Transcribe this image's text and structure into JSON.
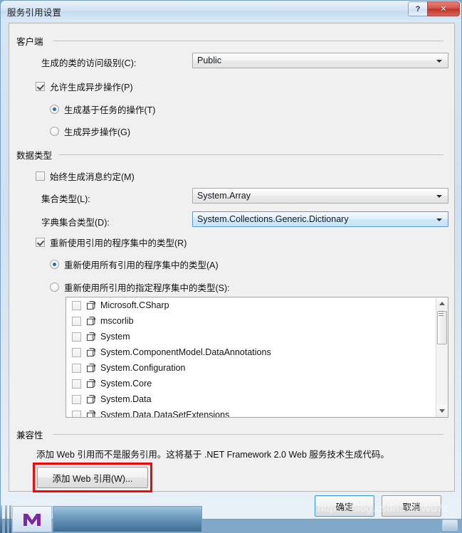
{
  "window": {
    "title": "服务引用设置",
    "help_button": "?",
    "close_button": "✕"
  },
  "sections": {
    "client": {
      "title": "客户端",
      "access_level_label": "生成的类的访问级别(C):",
      "access_level_value": "Public",
      "allow_async_label": "允许生成异步操作(P)",
      "allow_async_checked": true,
      "task_based_label": "生成基于任务的操作(T)",
      "async_op_label": "生成异步操作(G)",
      "op_selected": "task_based"
    },
    "datatype": {
      "title": "数据类型",
      "always_message_contract_label": "始终生成消息约定(M)",
      "always_message_contract_checked": false,
      "collection_type_label": "集合类型(L):",
      "collection_type_value": "System.Array",
      "dictionary_type_label": "字典集合类型(D):",
      "dictionary_type_value": "System.Collections.Generic.Dictionary",
      "dictionary_focused": true,
      "reuse_types_label": "重新使用引用的程序集中的类型(R)",
      "reuse_types_checked": true,
      "reuse_all_label": "重新使用所有引用的程序集中的类型(A)",
      "reuse_specified_label": "重新使用所引用的指定程序集中的类型(S):",
      "reuse_selected": "reuse_all",
      "assemblies": [
        {
          "name": "Microsoft.CSharp",
          "checked": false
        },
        {
          "name": "mscorlib",
          "checked": false
        },
        {
          "name": "System",
          "checked": false
        },
        {
          "name": "System.ComponentModel.DataAnnotations",
          "checked": false
        },
        {
          "name": "System.Configuration",
          "checked": false
        },
        {
          "name": "System.Core",
          "checked": false
        },
        {
          "name": "System.Data",
          "checked": false
        },
        {
          "name": "System.Data.DataSetExtensions",
          "checked": false
        }
      ]
    },
    "compatibility": {
      "title": "兼容性",
      "description": "添加 Web 引用而不是服务引用。这将基于 .NET Framework 2.0 Web 服务技术生成代码。",
      "add_web_reference_button": "添加 Web 引用(W)..."
    }
  },
  "footer": {
    "ok_button": "确定",
    "cancel_button": "取消"
  },
  "overlay": {
    "watermark": "https://blog.csdn.net/Wu7z_"
  },
  "colors": {
    "annotation": "#f40606",
    "accent": "#3c9bd6",
    "title_bar": "#d4e4f4"
  }
}
